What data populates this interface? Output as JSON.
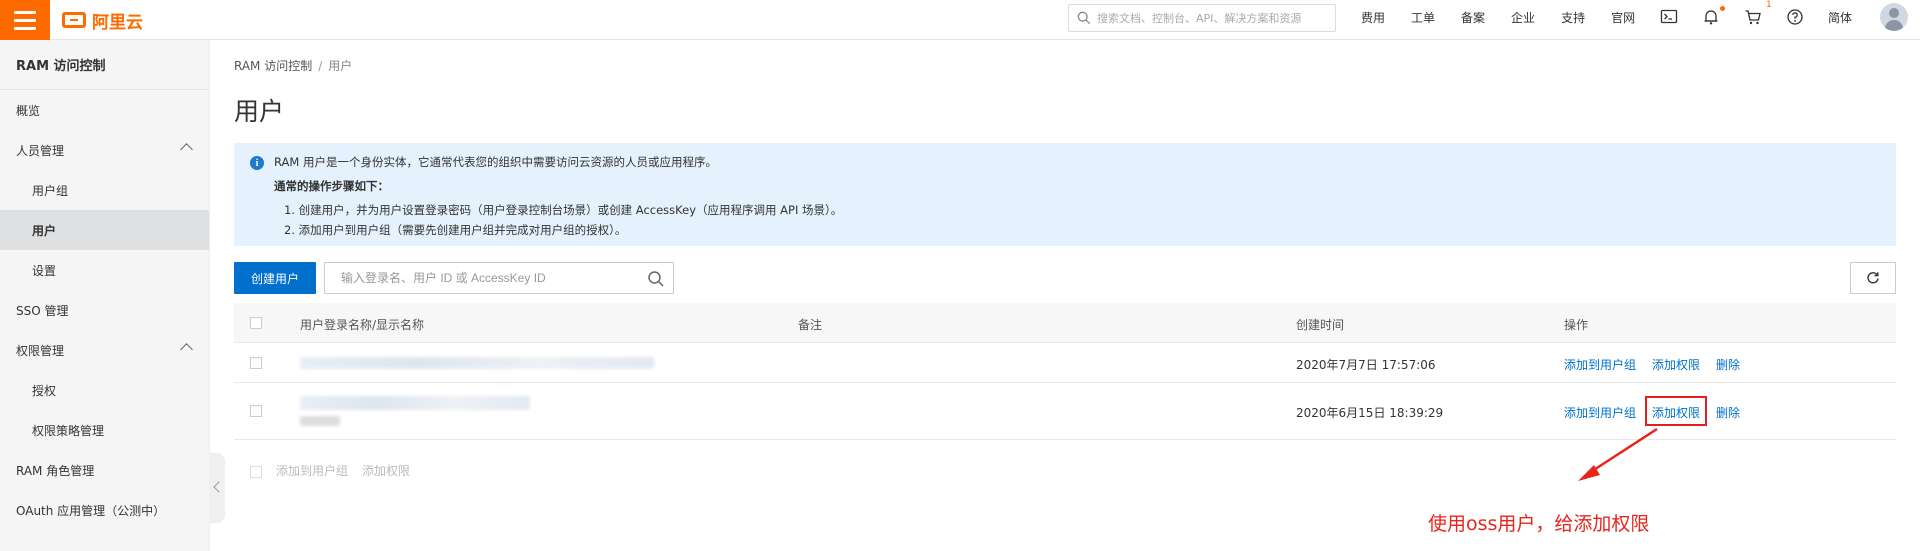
{
  "header": {
    "logo_text": "阿里云",
    "search_placeholder": "搜索文档、控制台、API、解决方案和资源",
    "nav": [
      "费用",
      "工单",
      "备案",
      "企业",
      "支持",
      "官网"
    ],
    "cart_count": "1",
    "lang": "简体",
    "icons": [
      "terminal-icon",
      "bell-icon",
      "cart-icon",
      "help-icon"
    ]
  },
  "sidebar": {
    "title": "RAM 访问控制",
    "items": [
      {
        "label": "概览",
        "level": 1
      },
      {
        "label": "人员管理",
        "level": 1,
        "expanded": true
      },
      {
        "label": "用户组",
        "level": 2
      },
      {
        "label": "用户",
        "level": 2,
        "active": true
      },
      {
        "label": "设置",
        "level": 2
      },
      {
        "label": "SSO 管理",
        "level": 1
      },
      {
        "label": "权限管理",
        "level": 1,
        "expanded": true
      },
      {
        "label": "授权",
        "level": 2
      },
      {
        "label": "权限策略管理",
        "level": 2
      },
      {
        "label": "RAM 角色管理",
        "level": 1
      },
      {
        "label": "OAuth 应用管理（公测中）",
        "level": 1
      }
    ]
  },
  "breadcrumb": {
    "root": "RAM 访问控制",
    "sep": "/",
    "current": "用户"
  },
  "page_title": "用户",
  "info": {
    "line1": "RAM 用户是一个身份实体，它通常代表您的组织中需要访问云资源的人员或应用程序。",
    "line2": "通常的操作步骤如下：",
    "line3": "1. 创建用户，并为用户设置登录密码（用户登录控制台场景）或创建 AccessKey（应用程序调用 API 场景）。",
    "line4": "2. 添加用户到用户组（需要先创建用户组并完成对用户组的授权）。"
  },
  "toolbar": {
    "create_button": "创建用户",
    "search_placeholder": "输入登录名、用户 ID 或 AccessKey ID"
  },
  "table": {
    "columns": [
      "用户登录名称/显示名称",
      "备注",
      "创建时间",
      "操作"
    ],
    "rows": [
      {
        "created": "2020年7月7日 17:57:06",
        "actions": [
          "添加到用户组",
          "添加权限",
          "删除"
        ]
      },
      {
        "created": "2020年6月15日 18:39:29",
        "actions": [
          "添加到用户组",
          "添加权限",
          "删除"
        ]
      }
    ],
    "batch_actions": [
      "添加到用户组",
      "添加权限"
    ]
  },
  "annotation": {
    "text": "使用oss用户，给添加权限",
    "color": "#e8251b"
  },
  "colors": {
    "brand": "#ff6a00",
    "primary": "#0070cc",
    "info_bg": "#e5f2fd"
  }
}
